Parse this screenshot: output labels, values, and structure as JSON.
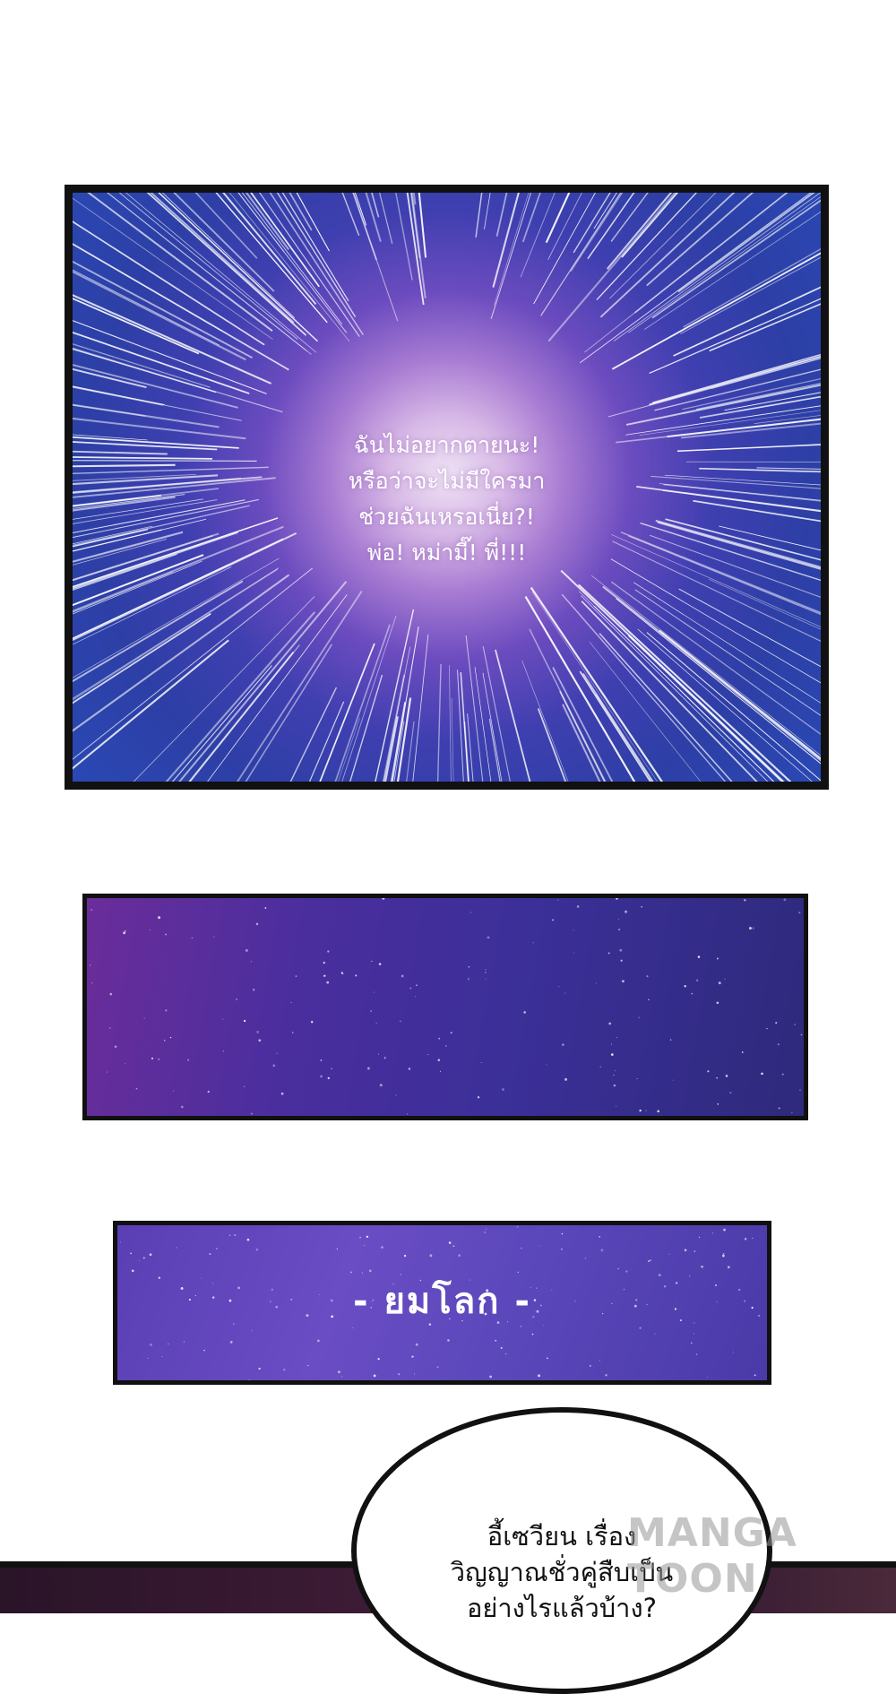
{
  "panel1": {
    "lines": [
      "ฉันไม่อยากตายนะ!",
      "หรือว่าจะไม่มีใครมา",
      "ช่วยฉันเหรอเนี่ย?!",
      "พ่อ! หม่ามี๊! พี่!!!"
    ]
  },
  "panel3": {
    "title": "- ยมโลก -"
  },
  "bubble": {
    "lines": [
      "อี้เซวียน เรื่อง",
      "วิญญาณชั่วคู่สืบเป็น",
      "อย่างไรแล้วบ้าง?"
    ]
  },
  "watermark": "MANGA TOON",
  "colors": {
    "panel_border": "#111111",
    "glow_center": "#efe2f5",
    "sky_blue": "#2d3fa6",
    "sky_purple": "#4a2e9e"
  }
}
